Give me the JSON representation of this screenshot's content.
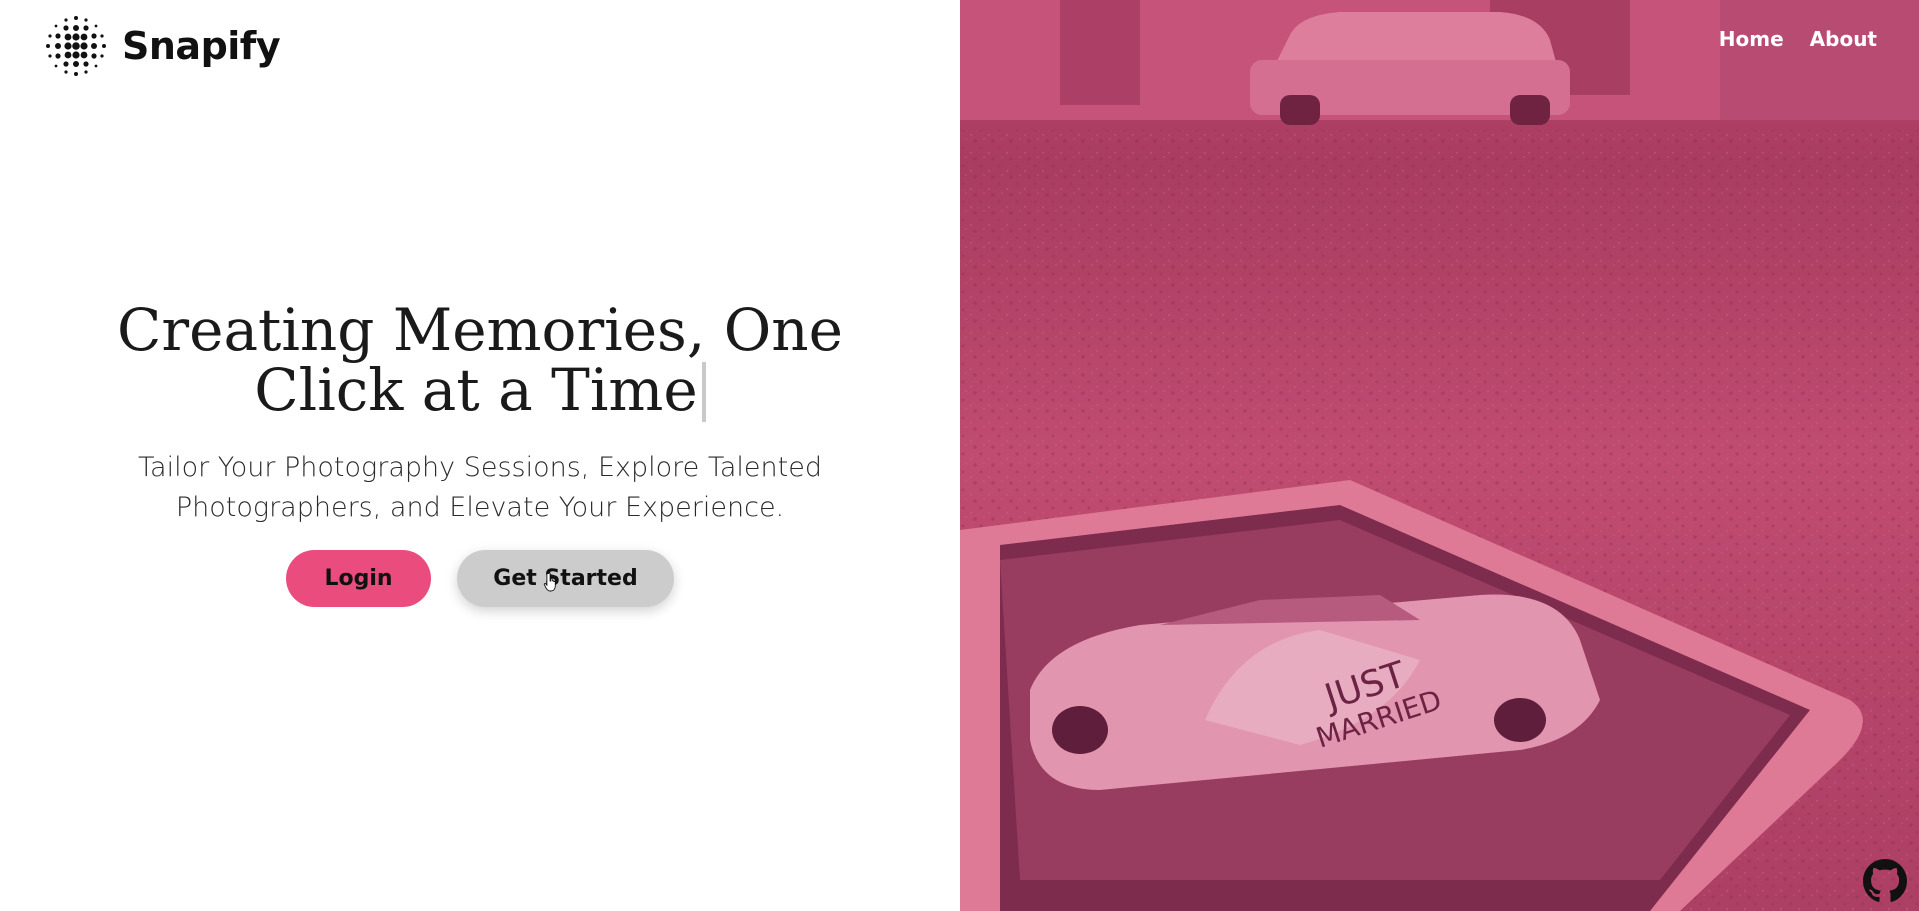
{
  "brand": {
    "name": "Snapify",
    "logo_icon": "dot-grid-logo-icon"
  },
  "nav": {
    "home": "Home",
    "about": "About"
  },
  "hero": {
    "title_line1": "Creating Memories, One",
    "title_line2": "Click at a Time",
    "subtitle": "Tailor Your Photography Sessions, Explore Talented Photographers, and Elevate Your Experience."
  },
  "buttons": {
    "login": "Login",
    "get_started": "Get Started"
  },
  "photo": {
    "sign_line1": "JUST",
    "sign_line2": "MARRIED"
  },
  "footer": {
    "github_icon": "github-icon"
  },
  "colors": {
    "accent": "#ea4c7e",
    "overlay": "#c44a70",
    "secondary_button": "#cccccc"
  }
}
